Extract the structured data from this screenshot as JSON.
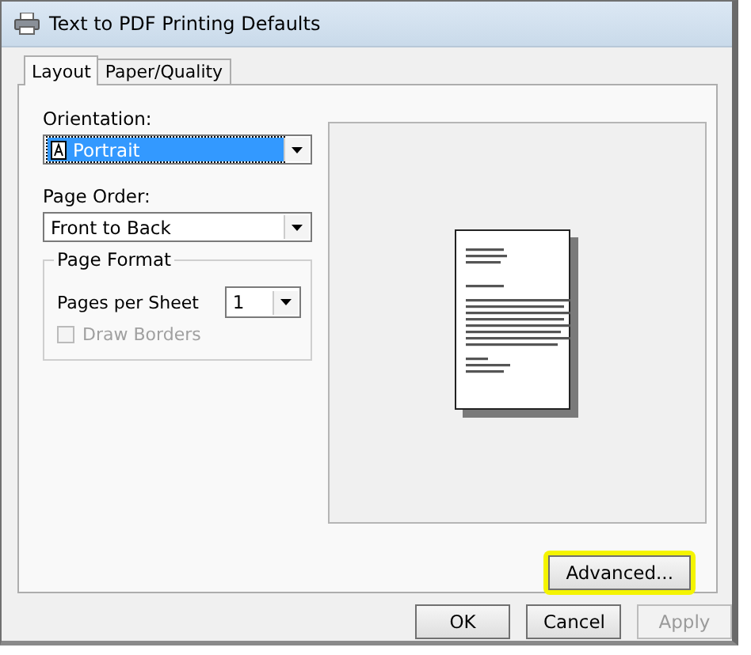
{
  "window": {
    "title": "Text to PDF Printing Defaults"
  },
  "tabs": [
    {
      "label": "Layout",
      "selected": true
    },
    {
      "label": "Paper/Quality",
      "selected": false
    }
  ],
  "orientation": {
    "label": "Orientation:",
    "value": "Portrait",
    "focused": true
  },
  "page_order": {
    "label": "Page Order:",
    "value": "Front to Back"
  },
  "page_format": {
    "title": "Page Format",
    "pages_per_sheet": {
      "label": "Pages per Sheet",
      "value": "1"
    },
    "draw_borders": {
      "label": "Draw Borders",
      "checked": false,
      "disabled": true
    }
  },
  "advanced_button": {
    "label": "Advanced...",
    "highlighted": true
  },
  "buttons": [
    {
      "label": "OK",
      "disabled": false
    },
    {
      "label": "Cancel",
      "disabled": false
    },
    {
      "label": "Apply",
      "disabled": true
    }
  ]
}
